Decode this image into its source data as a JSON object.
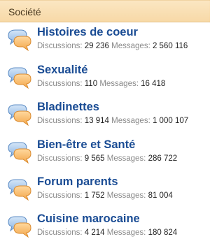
{
  "section": {
    "title": "Société"
  },
  "forums": [
    {
      "title": "Histoires de coeur",
      "discussions_label": "Discussions:",
      "discussions": "29 236",
      "messages_label": "Messages:",
      "messages": "2 560 116",
      "icon": "chat-bubbles-icon"
    },
    {
      "title": "Sexualité",
      "discussions_label": "Discussions:",
      "discussions": "110",
      "messages_label": "Messages:",
      "messages": "16 418",
      "icon": "chat-bubbles-icon"
    },
    {
      "title": "Bladinettes",
      "discussions_label": "Discussions:",
      "discussions": "13 914",
      "messages_label": "Messages:",
      "messages": "1 000 107",
      "icon": "chat-bubbles-icon"
    },
    {
      "title": "Bien-être et Santé",
      "discussions_label": "Discussions:",
      "discussions": "9 565",
      "messages_label": "Messages:",
      "messages": "286 722",
      "icon": "chat-bubbles-icon"
    },
    {
      "title": "Forum parents",
      "discussions_label": "Discussions:",
      "discussions": "1 752",
      "messages_label": "Messages:",
      "messages": "81 004",
      "icon": "chat-bubbles-icon"
    },
    {
      "title": "Cuisine marocaine",
      "discussions_label": "Discussions:",
      "discussions": "4 214",
      "messages_label": "Messages:",
      "messages": "180 824",
      "icon": "chat-bubbles-icon"
    }
  ],
  "colors": {
    "header_bg": "#f7d9a7",
    "title_blue": "#1a4c94",
    "label_gray": "#8a8a8a",
    "bubble_blue": "#6f9fd6",
    "bubble_orange": "#f3a64a"
  }
}
